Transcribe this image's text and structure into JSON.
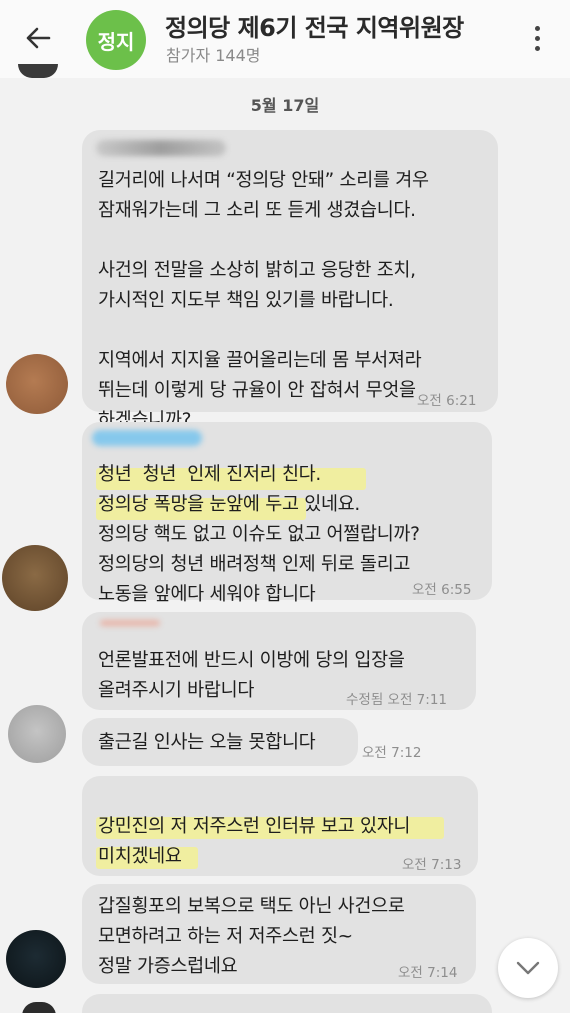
{
  "header": {
    "title": "정의당 제6기 전국 지역위원장",
    "participants": "참가자 144명",
    "logo_text": "정지",
    "logo_color": "#6cc04a"
  },
  "chat": {
    "date": "5월 17일",
    "messages": [
      {
        "text": "길거리에 나서며 “정의당 안돼” 소리를 겨우\n잠재워가는데 그 소리 또 듣게 생겼습니다.\n\n사건의 전말을 소상히 밝히고 응당한 조치,\n가시적인 지도부 책임 있기를 바랍니다.\n\n지역에서 지지율 끌어올리는데 몸 부서져라\n뛰는데 이렇게 당 규율이 안 잡혀서 무엇을\n하겠습니까?",
        "time": "오전 6:21"
      },
      {
        "text": "청년  청년  인제 진저리 친다.\n정의당 폭망을 눈앞에 두고 있네요.\n정의당 핵도 없고 이슈도 없고 어쩔랍니까?\n정의당의 청년 배려정책 인제 뒤로 돌리고\n노동을 앞에다 세워야 합니다",
        "time": "오전 6:55"
      },
      {
        "text": "언론발표전에 반드시 이방에 당의 입장을\n올려주시기 바랍니다",
        "time": "수정됨 오전 7:11"
      },
      {
        "text": "출근길 인사는 오늘 못합니다",
        "time": "오전 7:12"
      },
      {
        "text": "강민진의 저 저주스런 인터뷰 보고 있자니\n미치겠네요",
        "time": "오전 7:13"
      },
      {
        "text": "갑질횡포의 보복으로 택도 아닌 사건으로\n모면하려고 하는 저 저주스런 짓~\n정말 가증스럽네요",
        "time": "오전 7:14"
      }
    ]
  },
  "colors": {
    "bubble": "#e2e2e2",
    "highlight": "#f4f28a",
    "background": "#f2f2f2"
  },
  "icons": {
    "back": "arrow-left-icon",
    "more": "more-vertical-icon",
    "scroll": "chevron-down-icon"
  }
}
